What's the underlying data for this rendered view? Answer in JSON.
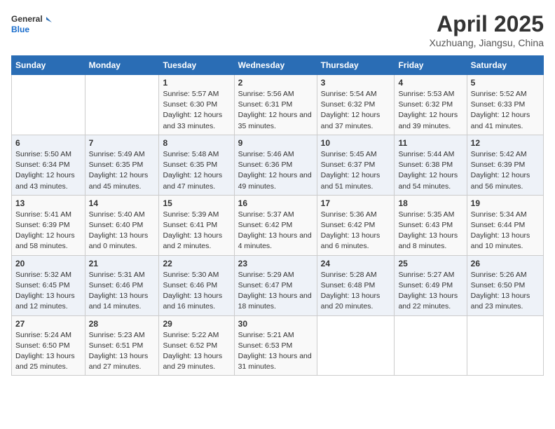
{
  "logo": {
    "line1": "General",
    "line2": "Blue"
  },
  "title": "April 2025",
  "subtitle": "Xuzhuang, Jiangsu, China",
  "days_of_week": [
    "Sunday",
    "Monday",
    "Tuesday",
    "Wednesday",
    "Thursday",
    "Friday",
    "Saturday"
  ],
  "weeks": [
    [
      {
        "day": "",
        "info": ""
      },
      {
        "day": "",
        "info": ""
      },
      {
        "day": "1",
        "info": "Sunrise: 5:57 AM\nSunset: 6:30 PM\nDaylight: 12 hours and 33 minutes."
      },
      {
        "day": "2",
        "info": "Sunrise: 5:56 AM\nSunset: 6:31 PM\nDaylight: 12 hours and 35 minutes."
      },
      {
        "day": "3",
        "info": "Sunrise: 5:54 AM\nSunset: 6:32 PM\nDaylight: 12 hours and 37 minutes."
      },
      {
        "day": "4",
        "info": "Sunrise: 5:53 AM\nSunset: 6:32 PM\nDaylight: 12 hours and 39 minutes."
      },
      {
        "day": "5",
        "info": "Sunrise: 5:52 AM\nSunset: 6:33 PM\nDaylight: 12 hours and 41 minutes."
      }
    ],
    [
      {
        "day": "6",
        "info": "Sunrise: 5:50 AM\nSunset: 6:34 PM\nDaylight: 12 hours and 43 minutes."
      },
      {
        "day": "7",
        "info": "Sunrise: 5:49 AM\nSunset: 6:35 PM\nDaylight: 12 hours and 45 minutes."
      },
      {
        "day": "8",
        "info": "Sunrise: 5:48 AM\nSunset: 6:35 PM\nDaylight: 12 hours and 47 minutes."
      },
      {
        "day": "9",
        "info": "Sunrise: 5:46 AM\nSunset: 6:36 PM\nDaylight: 12 hours and 49 minutes."
      },
      {
        "day": "10",
        "info": "Sunrise: 5:45 AM\nSunset: 6:37 PM\nDaylight: 12 hours and 51 minutes."
      },
      {
        "day": "11",
        "info": "Sunrise: 5:44 AM\nSunset: 6:38 PM\nDaylight: 12 hours and 54 minutes."
      },
      {
        "day": "12",
        "info": "Sunrise: 5:42 AM\nSunset: 6:39 PM\nDaylight: 12 hours and 56 minutes."
      }
    ],
    [
      {
        "day": "13",
        "info": "Sunrise: 5:41 AM\nSunset: 6:39 PM\nDaylight: 12 hours and 58 minutes."
      },
      {
        "day": "14",
        "info": "Sunrise: 5:40 AM\nSunset: 6:40 PM\nDaylight: 13 hours and 0 minutes."
      },
      {
        "day": "15",
        "info": "Sunrise: 5:39 AM\nSunset: 6:41 PM\nDaylight: 13 hours and 2 minutes."
      },
      {
        "day": "16",
        "info": "Sunrise: 5:37 AM\nSunset: 6:42 PM\nDaylight: 13 hours and 4 minutes."
      },
      {
        "day": "17",
        "info": "Sunrise: 5:36 AM\nSunset: 6:42 PM\nDaylight: 13 hours and 6 minutes."
      },
      {
        "day": "18",
        "info": "Sunrise: 5:35 AM\nSunset: 6:43 PM\nDaylight: 13 hours and 8 minutes."
      },
      {
        "day": "19",
        "info": "Sunrise: 5:34 AM\nSunset: 6:44 PM\nDaylight: 13 hours and 10 minutes."
      }
    ],
    [
      {
        "day": "20",
        "info": "Sunrise: 5:32 AM\nSunset: 6:45 PM\nDaylight: 13 hours and 12 minutes."
      },
      {
        "day": "21",
        "info": "Sunrise: 5:31 AM\nSunset: 6:46 PM\nDaylight: 13 hours and 14 minutes."
      },
      {
        "day": "22",
        "info": "Sunrise: 5:30 AM\nSunset: 6:46 PM\nDaylight: 13 hours and 16 minutes."
      },
      {
        "day": "23",
        "info": "Sunrise: 5:29 AM\nSunset: 6:47 PM\nDaylight: 13 hours and 18 minutes."
      },
      {
        "day": "24",
        "info": "Sunrise: 5:28 AM\nSunset: 6:48 PM\nDaylight: 13 hours and 20 minutes."
      },
      {
        "day": "25",
        "info": "Sunrise: 5:27 AM\nSunset: 6:49 PM\nDaylight: 13 hours and 22 minutes."
      },
      {
        "day": "26",
        "info": "Sunrise: 5:26 AM\nSunset: 6:50 PM\nDaylight: 13 hours and 23 minutes."
      }
    ],
    [
      {
        "day": "27",
        "info": "Sunrise: 5:24 AM\nSunset: 6:50 PM\nDaylight: 13 hours and 25 minutes."
      },
      {
        "day": "28",
        "info": "Sunrise: 5:23 AM\nSunset: 6:51 PM\nDaylight: 13 hours and 27 minutes."
      },
      {
        "day": "29",
        "info": "Sunrise: 5:22 AM\nSunset: 6:52 PM\nDaylight: 13 hours and 29 minutes."
      },
      {
        "day": "30",
        "info": "Sunrise: 5:21 AM\nSunset: 6:53 PM\nDaylight: 13 hours and 31 minutes."
      },
      {
        "day": "",
        "info": ""
      },
      {
        "day": "",
        "info": ""
      },
      {
        "day": "",
        "info": ""
      }
    ]
  ]
}
